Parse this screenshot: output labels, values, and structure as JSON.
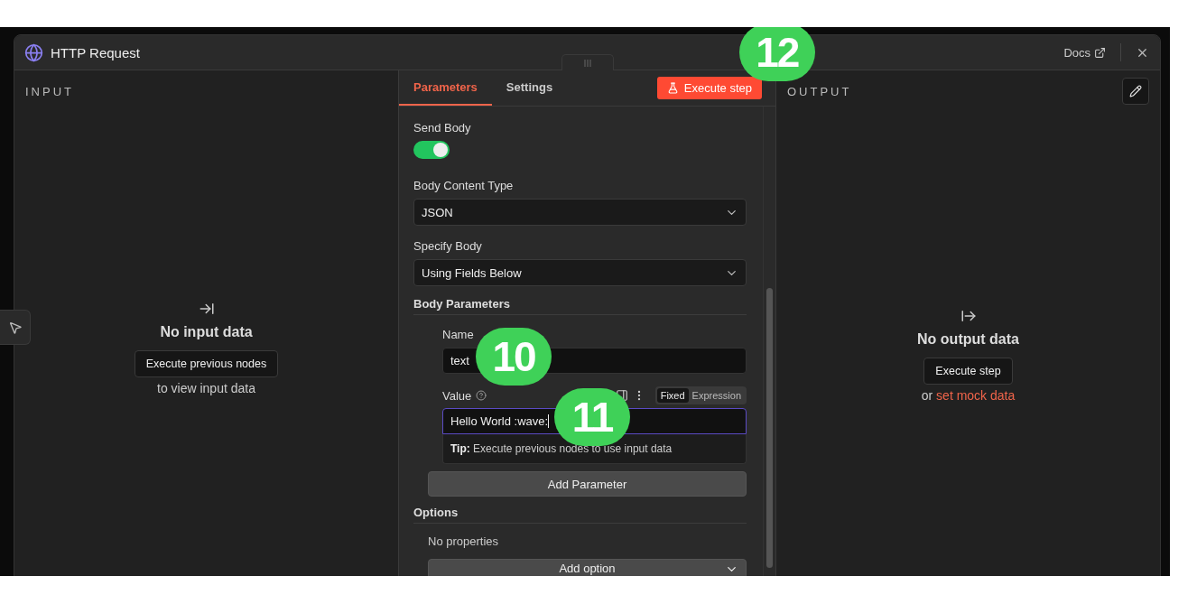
{
  "window": {
    "title": "HTTP Request",
    "docs_link": "Docs"
  },
  "input_panel": {
    "heading": "INPUT",
    "empty_title": "No input data",
    "action": "Execute previous nodes",
    "hint": "to view input data"
  },
  "parameters": {
    "tabs": [
      {
        "label": "Parameters",
        "selected": true
      },
      {
        "label": "Settings",
        "selected": false
      }
    ],
    "execute_button": "Execute step",
    "execute_callout": "12",
    "fields": [
      {
        "kind": "toggle",
        "label": "Send Body",
        "on": true
      },
      {
        "kind": "select",
        "label": "Body Content Type",
        "value": "JSON"
      },
      {
        "kind": "select",
        "label": "Specify Body",
        "value": "Using Fields Below"
      }
    ],
    "body_parameters": {
      "heading": "Body Parameters",
      "name": {
        "label": "Name",
        "value": "text",
        "callout": "10"
      },
      "value": {
        "label": "Value",
        "modes": [
          {
            "label": "Fixed",
            "selected": true
          },
          {
            "label": "Expression",
            "selected": false
          }
        ],
        "value": "Hello World :wave:",
        "focused": true,
        "callout": "11",
        "tip": "**Tip:** Execute previous nodes to use input data"
      },
      "add_button": "Add Parameter"
    },
    "options": {
      "heading": "Options",
      "empty": "No properties",
      "add_button": "Add option"
    }
  },
  "output_panel": {
    "heading": "OUTPUT",
    "empty_title": "No output data",
    "action": "Execute step",
    "hint_prefix": "or",
    "hint_link": "set mock data"
  }
}
